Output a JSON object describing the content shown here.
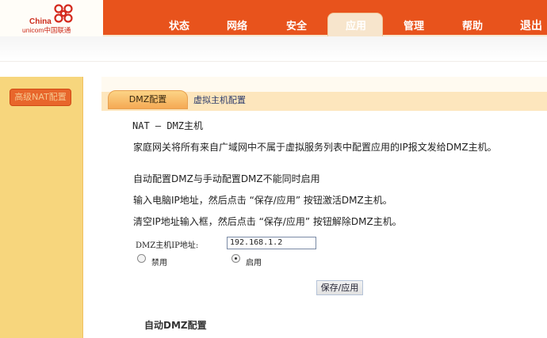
{
  "header": {
    "logo_text_top": "China",
    "logo_text_bottom": "unicom中国联通",
    "nav_items": [
      "状态",
      "网络",
      "安全",
      "应用",
      "管理",
      "帮助",
      "退出"
    ],
    "active_nav": "应用"
  },
  "sidebar": {
    "items": [
      {
        "label": "高级NAT配置"
      }
    ]
  },
  "tabs": [
    {
      "label": "DMZ配置",
      "active": true
    },
    {
      "label": "虚拟主机配置",
      "active": false
    }
  ],
  "main": {
    "title": "NAT — DMZ主机",
    "description": "家庭网关将所有来自广域网中不属于虚拟服务列表中配置应用的IP报文发给DMZ主机。",
    "note1": "自动配置DMZ与手动配置DMZ不能同时启用",
    "note2": "输入电脑IP地址，然后点击 “保存/应用” 按钮激活DMZ主机。",
    "note3": "清空IP地址输入框，然后点击 “保存/应用” 按钮解除DMZ主机。",
    "ip_label": "DMZ主机IP地址:",
    "ip_value": "192.168.1.2",
    "radio_disable": "禁用",
    "radio_enable": "启用",
    "radio_selected": "启用",
    "save_button": "保存/应用",
    "section_title": "自动DMZ配置"
  },
  "colors": {
    "brand_orange": "#e8531c",
    "sidebar_yellow": "#f7d67d",
    "tab_orange": "#f5a954"
  }
}
